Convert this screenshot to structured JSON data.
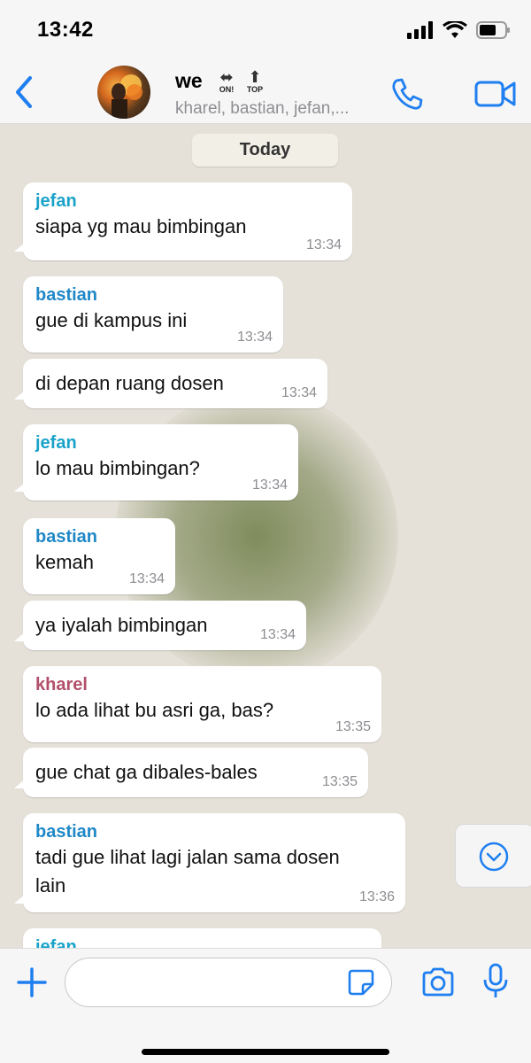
{
  "status_bar": {
    "time": "13:42"
  },
  "header": {
    "group_name": "we",
    "emoji_1": {
      "arrow": "⬌",
      "label": "ON!"
    },
    "emoji_2": {
      "arrow": "⬆",
      "label": "TOP"
    },
    "members": "kharel, bastian, jefan,..."
  },
  "chat": {
    "date_chip": "Today",
    "messages": [
      {
        "sender": "jefan",
        "text": "siapa yg mau bimbingan",
        "time": "13:34"
      },
      {
        "sender": "bastian",
        "text": "gue di kampus ini",
        "time": "13:34"
      },
      {
        "sender": "",
        "text": "di depan ruang dosen",
        "time": "13:34"
      },
      {
        "sender": "jefan",
        "text": "lo mau bimbingan?",
        "time": "13:34"
      },
      {
        "sender": "bastian",
        "text": "kemah",
        "time": "13:34"
      },
      {
        "sender": "",
        "text": "ya iyalah bimbingan",
        "time": "13:34"
      },
      {
        "sender": "kharel",
        "text": "lo ada lihat bu asri ga, bas?",
        "time": "13:35"
      },
      {
        "sender": "",
        "text": "gue chat ga dibales-bales",
        "time": "13:35"
      },
      {
        "sender": "bastian",
        "text": "tadi gue lihat lagi jalan sama dosen lain",
        "time": "13:36"
      },
      {
        "sender": "jefan",
        "text": "",
        "time": ""
      }
    ]
  },
  "colors": {
    "accent": "#1f7ff0",
    "jefan": "#1aa3c9",
    "bastian": "#1f88c7",
    "kharel": "#b2506b"
  },
  "icons": {
    "back": "chevron-left-icon",
    "call": "phone-icon",
    "video": "video-camera-icon",
    "plus": "plus-icon",
    "sticker": "sticker-icon",
    "camera": "camera-icon",
    "mic": "microphone-icon",
    "scroll": "chevron-down-circle-icon"
  }
}
